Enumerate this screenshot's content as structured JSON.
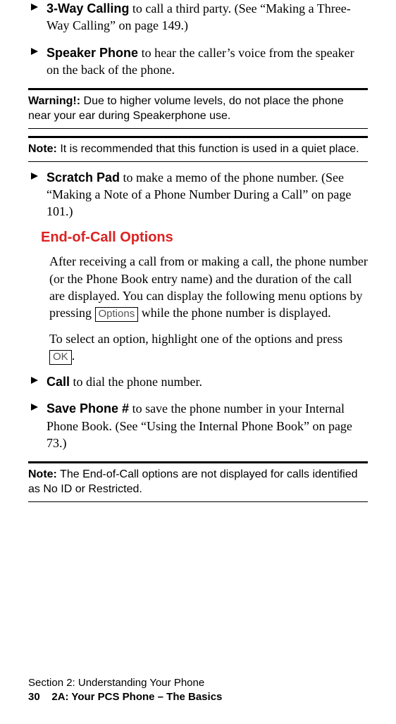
{
  "bullets_top": [
    {
      "term": "3-Way Calling",
      "rest": " to call a third party. (See “Making a Three-Way Calling” on page 149.)"
    },
    {
      "term": "Speaker Phone",
      "rest": " to hear the caller’s voice from the speaker on the back of the phone."
    }
  ],
  "warning": {
    "label": "Warning!:",
    "text": " Due to higher volume levels, do not place the phone near your ear during Speakerphone use."
  },
  "note1": {
    "label": "Note:",
    "text": " It is recommended that this function is used in a quiet place."
  },
  "bullet_scratch": {
    "term": "Scratch Pad",
    "rest": " to make a memo of the phone number. (See “Making a Note of a Phone Number During a Call” on page 101.)"
  },
  "section_heading": "End-of-Call Options",
  "para1_a": "After receiving a call from or making a call, the phone number (or the Phone Book entry name) and the duration of the call are displayed. You can display the following menu options by pressing ",
  "para1_key1": "Options",
  "para1_b": " while the phone number is displayed.",
  "para2_a": "To select an option, highlight one of the options and press ",
  "para2_key": "OK",
  "para2_b": ".",
  "bullets_end": [
    {
      "term": "Call",
      "rest": " to dial the phone number."
    },
    {
      "term": "Save Phone #",
      "rest": " to save the phone number in your Internal Phone Book. (See “Using the Internal Phone Book” on page 73.)"
    }
  ],
  "note2": {
    "label": "Note:",
    "text": " The End-of-Call options are not displayed for calls identified as No ID or Restricted."
  },
  "footer": {
    "line1": "Section 2: Understanding Your Phone",
    "page_number": "30",
    "chapter": "2A: Your PCS Phone – The Basics"
  }
}
